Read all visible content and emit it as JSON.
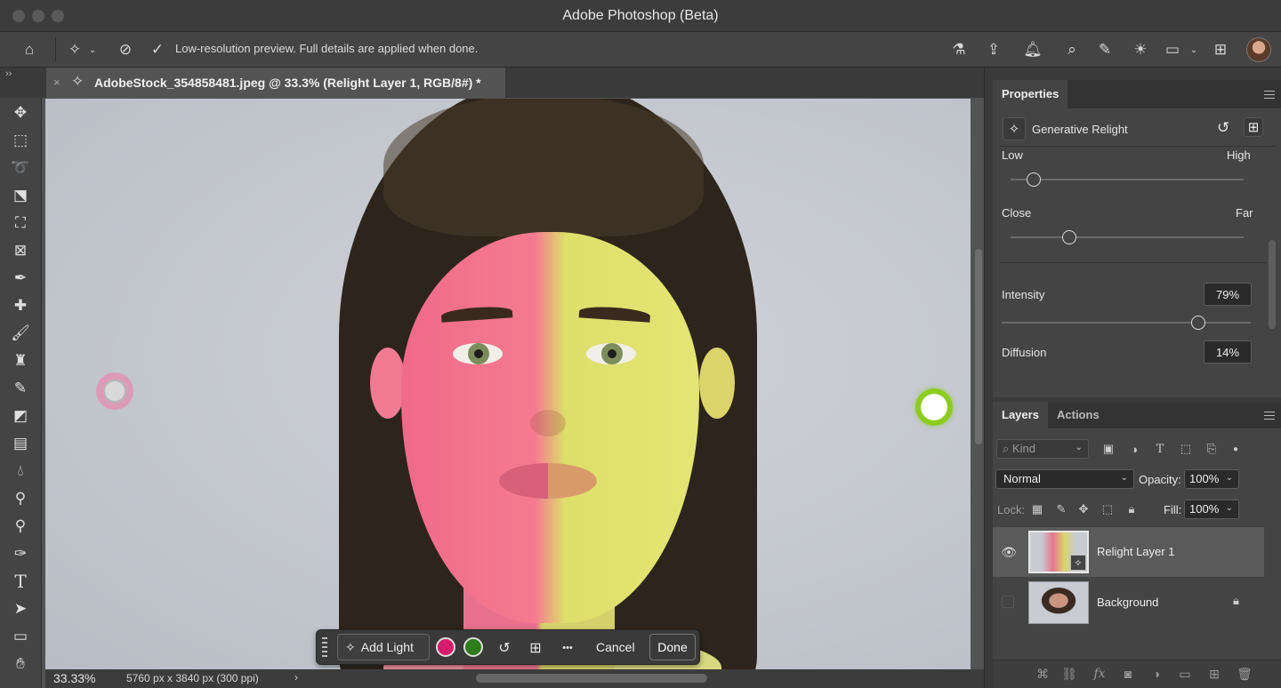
{
  "app": {
    "title": "Adobe Photoshop (Beta)"
  },
  "options_bar": {
    "message": "Low-resolution preview. Full details are applied when done."
  },
  "document_tab": {
    "name": "AdobeStock_354858481.jpeg @ 33.3% (Relight Layer 1, RGB/8#) *"
  },
  "context_bar": {
    "add_light_label": "Add Light",
    "cancel_label": "Cancel",
    "done_label": "Done",
    "swatch_colors": [
      "#d81b6a",
      "#2e7d1a"
    ],
    "more_label": "•••"
  },
  "status_bar": {
    "zoom": "33.33%",
    "dimensions": "5760 px x 3840 px (300 ppi)",
    "arrow": "›"
  },
  "properties": {
    "tab_label": "Properties",
    "header": "Generative Relight",
    "brightness": {
      "low_label": "Low",
      "high_label": "High",
      "level": 0.1
    },
    "distance": {
      "close_label": "Close",
      "far_label": "Far",
      "level": 0.25
    },
    "intensity": {
      "label": "Intensity",
      "value": "79%",
      "level": 0.79
    },
    "diffusion": {
      "label": "Diffusion",
      "value": "14%"
    }
  },
  "layers": {
    "tabs": [
      "Layers",
      "Actions"
    ],
    "kind_placeholder": "Kind",
    "blend_mode": "Normal",
    "opacity_label": "Opacity:",
    "opacity_value": "100%",
    "lock_label": "Lock:",
    "fill_label": "Fill:",
    "fill_value": "100%",
    "items": [
      {
        "name": "Relight Layer 1",
        "visible": true,
        "selected": true
      },
      {
        "name": "Background",
        "visible": false,
        "locked": true
      }
    ]
  },
  "light_colors": {
    "left_light": "#e79ab9",
    "right_light": "#8ccc1c"
  }
}
